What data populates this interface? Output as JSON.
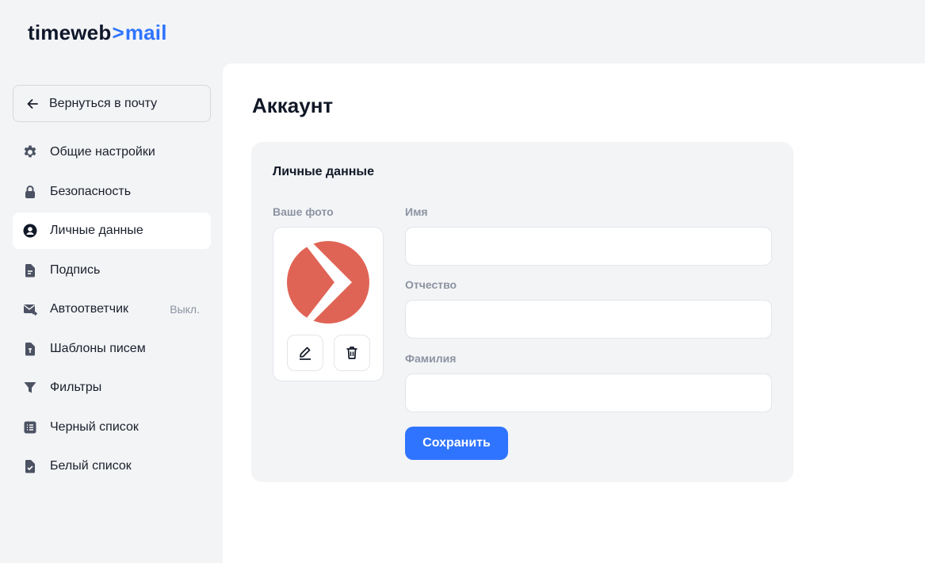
{
  "brand": {
    "part1": "timeweb",
    "separator": ">",
    "part2": "mail"
  },
  "sidebar": {
    "back_label": "Вернуться в почту",
    "items": [
      {
        "label": "Общие настройки",
        "icon": "gear-icon"
      },
      {
        "label": "Безопасность",
        "icon": "lock-icon"
      },
      {
        "label": "Личные данные",
        "icon": "user-circle-icon",
        "active": true
      },
      {
        "label": "Подпись",
        "icon": "document-icon"
      },
      {
        "label": "Автоответчик",
        "icon": "mail-forward-icon",
        "badge": "Выкл."
      },
      {
        "label": "Шаблоны писем",
        "icon": "template-icon"
      },
      {
        "label": "Фильтры",
        "icon": "filter-icon"
      },
      {
        "label": "Черный список",
        "icon": "list-icon"
      },
      {
        "label": "Белый список",
        "icon": "check-document-icon"
      }
    ]
  },
  "page": {
    "title": "Аккаунт",
    "card_title": "Личные данные",
    "photo_label": "Ваше фото",
    "fields": {
      "first_name": {
        "label": "Имя",
        "value": ""
      },
      "patronymic": {
        "label": "Отчество",
        "value": ""
      },
      "last_name": {
        "label": "Фамилия",
        "value": ""
      }
    },
    "save_label": "Сохранить"
  },
  "colors": {
    "accent": "#2f74ff",
    "avatar": "#e06456",
    "icon": "#4b5263"
  }
}
